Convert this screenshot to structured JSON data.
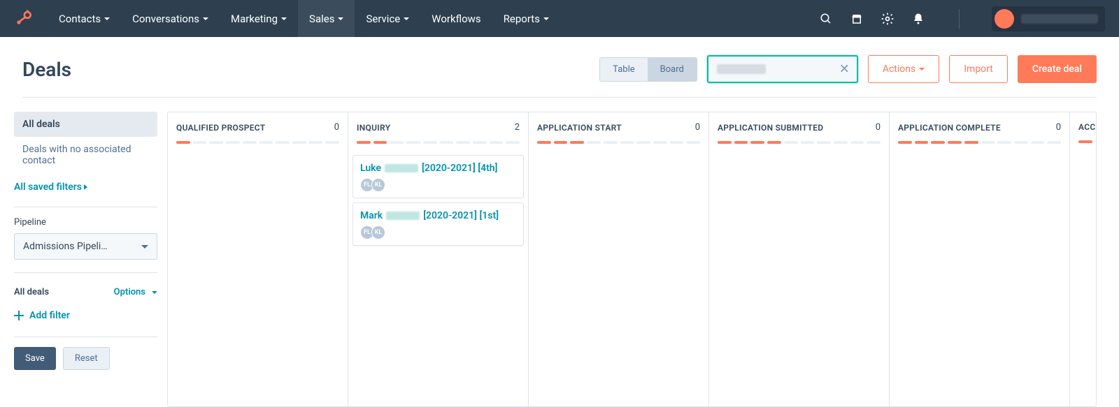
{
  "nav": {
    "items": [
      {
        "label": "Contacts",
        "caret": true
      },
      {
        "label": "Conversations",
        "caret": true
      },
      {
        "label": "Marketing",
        "caret": true
      },
      {
        "label": "Sales",
        "caret": true,
        "active": true
      },
      {
        "label": "Service",
        "caret": true
      },
      {
        "label": "Workflows",
        "caret": false
      },
      {
        "label": "Reports",
        "caret": true
      }
    ]
  },
  "page": {
    "title": "Deals"
  },
  "toolbar": {
    "view_table": "Table",
    "view_board": "Board",
    "actions": "Actions",
    "import": "Import",
    "create": "Create deal"
  },
  "sidebar": {
    "all_deals": "All deals",
    "no_contact": "Deals with no associated contact",
    "saved_filters": "All saved filters",
    "pipeline_label": "Pipeline",
    "pipeline_value": "Admissions Pipeli…",
    "all_deals_section": "All deals",
    "options": "Options",
    "add_filter": "Add filter",
    "save": "Save",
    "reset": "Reset"
  },
  "columns": [
    {
      "title": "QUALIFIED PROSPECT",
      "count": 0,
      "progress": 1,
      "cards": []
    },
    {
      "title": "INQUIRY",
      "count": 2,
      "progress": 2,
      "cards": [
        {
          "first": "Luke",
          "suffix": "[2020-2021] [4th]",
          "avatars": [
            "FL",
            "KL"
          ]
        },
        {
          "first": "Mark",
          "suffix": "[2020-2021] [1st]",
          "avatars": [
            "FL",
            "KL"
          ]
        }
      ]
    },
    {
      "title": "APPLICATION START",
      "count": 0,
      "progress": 3,
      "cards": []
    },
    {
      "title": "APPLICATION SUBMITTED",
      "count": 0,
      "progress": 4,
      "cards": []
    },
    {
      "title": "APPLICATION COMPLETE",
      "count": 0,
      "progress": 5,
      "cards": []
    },
    {
      "title": "ACC",
      "count": null,
      "progress": 1,
      "cards": []
    }
  ]
}
